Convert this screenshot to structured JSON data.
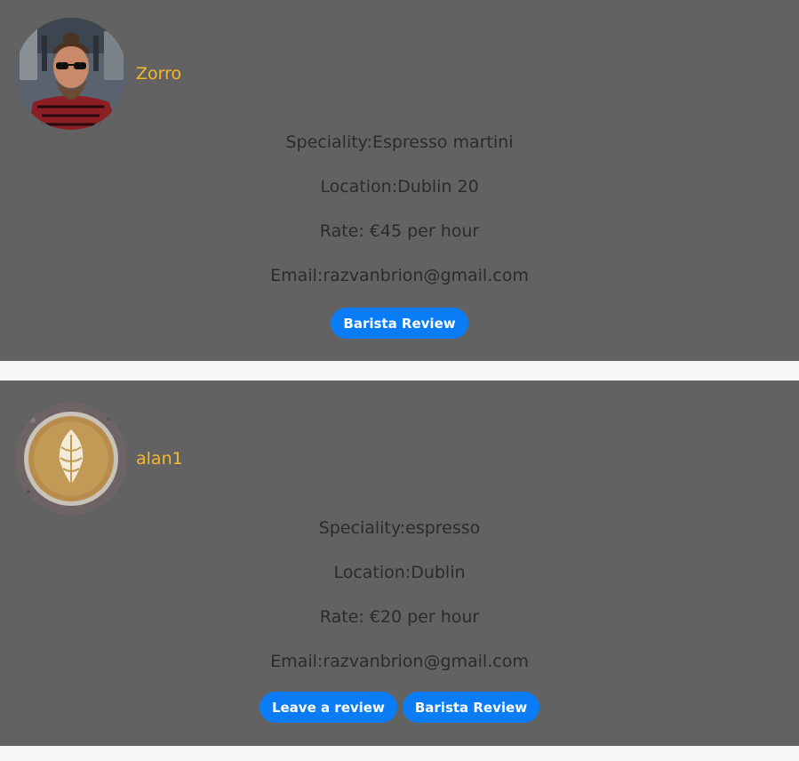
{
  "baristas": [
    {
      "name": "Zorro",
      "avatar_icon": "bearded-man-avatar",
      "speciality": "Speciality:Espresso martini",
      "location": "Location:Dublin 20",
      "rate": "Rate: €45 per hour",
      "email": "Email:razvanbrion@gmail.com",
      "barista_review_label": "Barista Review"
    },
    {
      "name": "alan1",
      "avatar_icon": "latte-art-avatar",
      "speciality": "Speciality:espresso",
      "location": "Location:Dublin",
      "rate": "Rate: €20 per hour",
      "email": "Email:razvanbrion@gmail.com",
      "leave_review_label": "Leave a review",
      "barista_review_label": "Barista Review"
    }
  ],
  "colors": {
    "card_bg": "#636263",
    "name": "#f5b82c",
    "button": "#0a7df6",
    "page_bg": "#f7f7f7"
  }
}
